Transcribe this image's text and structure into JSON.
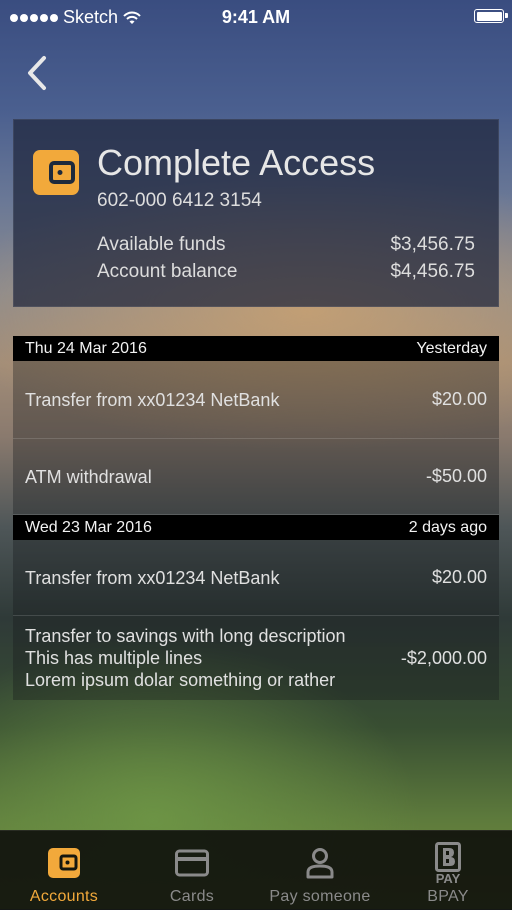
{
  "status_bar": {
    "carrier": "Sketch",
    "time": "9:41 AM"
  },
  "header": {
    "back_icon": "chevron-left-icon"
  },
  "account": {
    "icon": "wallet-icon",
    "name": "Complete Access",
    "number": "602-000 6412 3154",
    "available_label": "Available funds",
    "available_value": "$3,456.75",
    "balance_label": "Account balance",
    "balance_value": "$4,456.75"
  },
  "transactions": {
    "groups": [
      {
        "date": "Thu 24 Mar 2016",
        "relative": "Yesterday",
        "items": [
          {
            "description": "Transfer from xx01234 NetBank",
            "amount": "$20.00"
          },
          {
            "description": "ATM withdrawal",
            "amount": "-$50.00"
          }
        ]
      },
      {
        "date": "Wed 23 Mar 2016",
        "relative": "2 days ago",
        "items": [
          {
            "description": "Transfer from xx01234 NetBank",
            "amount": "$20.00"
          },
          {
            "description_lines": [
              "Transfer to savings with long description",
              "This has multiple lines",
              "Lorem ipsum dolar something or rather"
            ],
            "amount": "-$2,000.00"
          }
        ]
      }
    ]
  },
  "tabbar": {
    "accent_color": "#f2a93b",
    "tabs": [
      {
        "label": "Accounts",
        "icon": "wallet-icon",
        "active": true
      },
      {
        "label": "Cards",
        "icon": "card-icon",
        "active": false
      },
      {
        "label": "Pay someone",
        "icon": "person-icon",
        "active": false
      },
      {
        "label": "BPAY",
        "icon": "bpay-icon",
        "icon_text": "PAY",
        "active": false
      }
    ]
  }
}
